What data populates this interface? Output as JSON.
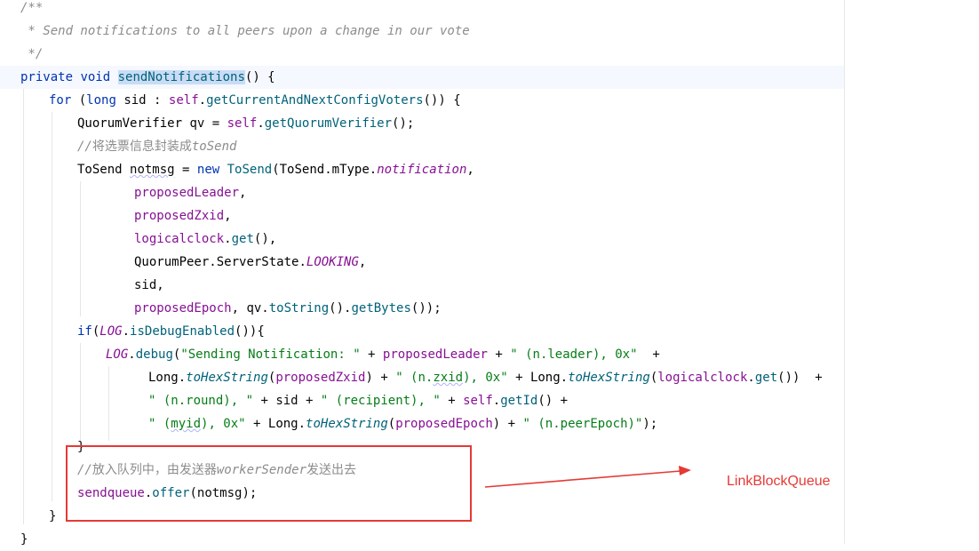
{
  "code_lines": [
    [
      {
        "t": "/**",
        "c": "doc"
      }
    ],
    [
      {
        "t": " * Send notifications to all peers upon a change in our vote",
        "c": "doc"
      }
    ],
    [
      {
        "t": " */",
        "c": "doc"
      }
    ],
    [
      {
        "t": "private ",
        "c": "kw"
      },
      {
        "t": "void ",
        "c": "kw"
      },
      {
        "t": "sendNotifications",
        "c": "fnsel"
      },
      {
        "t": "() {",
        "c": "op"
      }
    ],
    [
      {
        "t": "for ",
        "c": "kw"
      },
      {
        "t": "(",
        "c": "op"
      },
      {
        "t": "long ",
        "c": "kw"
      },
      {
        "t": "sid",
        "c": "var"
      },
      {
        "t": " : ",
        "c": "op"
      },
      {
        "t": "self",
        "c": "self"
      },
      {
        "t": ".",
        "c": "op"
      },
      {
        "t": "getCurrentAndNextConfigVoters",
        "c": "call"
      },
      {
        "t": "()) {",
        "c": "op"
      }
    ],
    [
      {
        "t": "QuorumVerifier ",
        "c": "cls"
      },
      {
        "t": "qv",
        "c": "var"
      },
      {
        "t": " = ",
        "c": "op"
      },
      {
        "t": "self",
        "c": "self"
      },
      {
        "t": ".",
        "c": "op"
      },
      {
        "t": "getQuorumVerifier",
        "c": "call"
      },
      {
        "t": "();",
        "c": "op"
      }
    ],
    [
      {
        "t": "//",
        "c": "cmt"
      },
      {
        "t": "将选票信息封装成",
        "c": "cmtcn"
      },
      {
        "t": "toSend",
        "c": "cmt"
      }
    ],
    [
      {
        "t": "ToSend ",
        "c": "cls"
      },
      {
        "t": "notmsg",
        "c": "var ul"
      },
      {
        "t": " = ",
        "c": "op"
      },
      {
        "t": "new ",
        "c": "kw"
      },
      {
        "t": "ToSend",
        "c": "call"
      },
      {
        "t": "(",
        "c": "op"
      },
      {
        "t": "ToSend",
        "c": "cls"
      },
      {
        "t": ".",
        "c": "op"
      },
      {
        "t": "mType",
        "c": "cls"
      },
      {
        "t": ".",
        "c": "op"
      },
      {
        "t": "notification",
        "c": "fielditalic"
      },
      {
        "t": ",",
        "c": "op"
      }
    ],
    [
      {
        "t": "proposedLeader",
        "c": "field"
      },
      {
        "t": ",",
        "c": "op"
      }
    ],
    [
      {
        "t": "proposedZxid",
        "c": "field"
      },
      {
        "t": ",",
        "c": "op"
      }
    ],
    [
      {
        "t": "logicalclock",
        "c": "field"
      },
      {
        "t": ".",
        "c": "op"
      },
      {
        "t": "get",
        "c": "call"
      },
      {
        "t": "(),",
        "c": "op"
      }
    ],
    [
      {
        "t": "QuorumPeer",
        "c": "cls"
      },
      {
        "t": ".",
        "c": "op"
      },
      {
        "t": "ServerState",
        "c": "cls"
      },
      {
        "t": ".",
        "c": "op"
      },
      {
        "t": "LOOKING",
        "c": "fielditalic"
      },
      {
        "t": ",",
        "c": "op"
      }
    ],
    [
      {
        "t": "sid",
        "c": "var"
      },
      {
        "t": ",",
        "c": "op"
      }
    ],
    [
      {
        "t": "proposedEpoch",
        "c": "field"
      },
      {
        "t": ", ",
        "c": "op"
      },
      {
        "t": "qv",
        "c": "var"
      },
      {
        "t": ".",
        "c": "op"
      },
      {
        "t": "toString",
        "c": "call"
      },
      {
        "t": "().",
        "c": "op"
      },
      {
        "t": "getBytes",
        "c": "call"
      },
      {
        "t": "());",
        "c": "op"
      }
    ],
    [
      {
        "t": "if",
        "c": "kw"
      },
      {
        "t": "(",
        "c": "op"
      },
      {
        "t": "LOG",
        "c": "fielditalic"
      },
      {
        "t": ".",
        "c": "op"
      },
      {
        "t": "isDebugEnabled",
        "c": "call"
      },
      {
        "t": "()){",
        "c": "op"
      }
    ],
    [
      {
        "t": "LOG",
        "c": "fielditalic"
      },
      {
        "t": ".",
        "c": "op"
      },
      {
        "t": "debug",
        "c": "call"
      },
      {
        "t": "(",
        "c": "op"
      },
      {
        "t": "\"Sending Notification: \"",
        "c": "str"
      },
      {
        "t": " + ",
        "c": "op"
      },
      {
        "t": "proposedLeader",
        "c": "field"
      },
      {
        "t": " + ",
        "c": "op"
      },
      {
        "t": "\" (n.leader), 0x\"",
        "c": "str"
      },
      {
        "t": "  +",
        "c": "op"
      }
    ],
    [
      {
        "t": "Long",
        "c": "cls"
      },
      {
        "t": ".",
        "c": "op"
      },
      {
        "t": "toHexString",
        "c": "callit"
      },
      {
        "t": "(",
        "c": "op"
      },
      {
        "t": "proposedZxid",
        "c": "field"
      },
      {
        "t": ") + ",
        "c": "op"
      },
      {
        "t": "\" (n.",
        "c": "str"
      },
      {
        "t": "zxid",
        "c": "str ul"
      },
      {
        "t": "), 0x\"",
        "c": "str"
      },
      {
        "t": " + ",
        "c": "op"
      },
      {
        "t": "Long",
        "c": "cls"
      },
      {
        "t": ".",
        "c": "op"
      },
      {
        "t": "toHexString",
        "c": "callit"
      },
      {
        "t": "(",
        "c": "op"
      },
      {
        "t": "logicalclock",
        "c": "field"
      },
      {
        "t": ".",
        "c": "op"
      },
      {
        "t": "get",
        "c": "call"
      },
      {
        "t": "())  +",
        "c": "op"
      }
    ],
    [
      {
        "t": "\" (n.round), \"",
        "c": "str"
      },
      {
        "t": " + ",
        "c": "op"
      },
      {
        "t": "sid",
        "c": "var"
      },
      {
        "t": " + ",
        "c": "op"
      },
      {
        "t": "\" (recipient), \"",
        "c": "str"
      },
      {
        "t": " + ",
        "c": "op"
      },
      {
        "t": "self",
        "c": "self"
      },
      {
        "t": ".",
        "c": "op"
      },
      {
        "t": "getId",
        "c": "call"
      },
      {
        "t": "() +",
        "c": "op"
      }
    ],
    [
      {
        "t": "\" (",
        "c": "str"
      },
      {
        "t": "myid",
        "c": "str ul"
      },
      {
        "t": "), 0x\"",
        "c": "str"
      },
      {
        "t": " + ",
        "c": "op"
      },
      {
        "t": "Long",
        "c": "cls"
      },
      {
        "t": ".",
        "c": "op"
      },
      {
        "t": "toHexString",
        "c": "callit"
      },
      {
        "t": "(",
        "c": "op"
      },
      {
        "t": "proposedEpoch",
        "c": "field"
      },
      {
        "t": ") + ",
        "c": "op"
      },
      {
        "t": "\" (n.peerEpoch)\"",
        "c": "str"
      },
      {
        "t": ");",
        "c": "op"
      }
    ],
    [
      {
        "t": "}",
        "c": "op"
      }
    ],
    [
      {
        "t": "//",
        "c": "cmt"
      },
      {
        "t": "放入队列中，由发送器",
        "c": "cmtcn"
      },
      {
        "t": "workerSender",
        "c": "cmt"
      },
      {
        "t": "发送出去",
        "c": "cmtcn"
      }
    ],
    [
      {
        "t": "sendqueue",
        "c": "field"
      },
      {
        "t": ".",
        "c": "op"
      },
      {
        "t": "offer",
        "c": "call"
      },
      {
        "t": "(",
        "c": "op"
      },
      {
        "t": "notmsg",
        "c": "var"
      },
      {
        "t": ");",
        "c": "op"
      }
    ],
    [
      {
        "t": "}",
        "c": "op"
      }
    ],
    [
      {
        "t": "}",
        "c": "op"
      }
    ]
  ],
  "annotation": {
    "label": "LinkBlockQueue",
    "color": "#e53935"
  }
}
